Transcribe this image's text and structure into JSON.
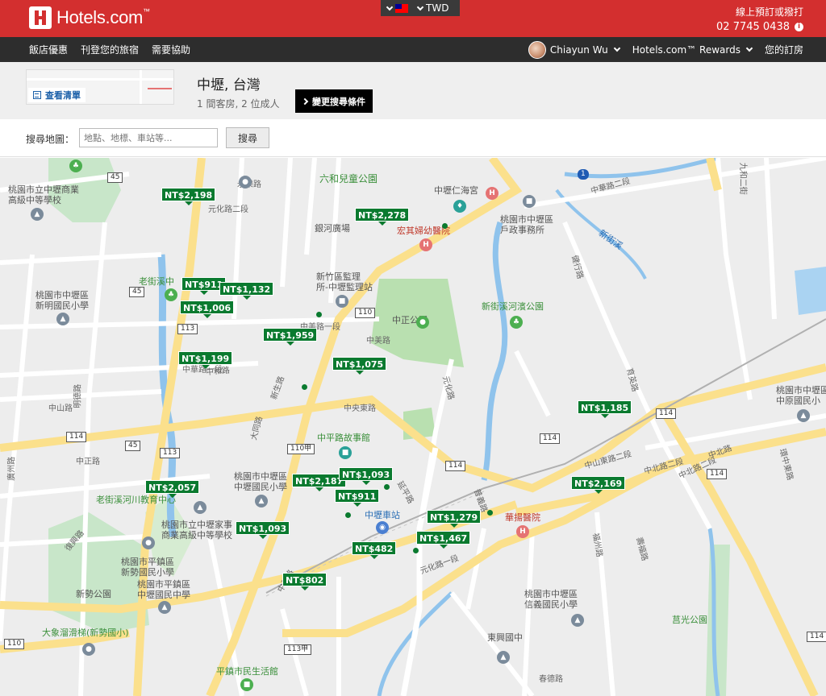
{
  "brand": {
    "name": "Hotels.com",
    "tm": "™"
  },
  "currency": {
    "code": "TWD"
  },
  "header": {
    "help_text": "線上預訂或撥打",
    "phone": "02 7745 0438",
    "info_glyph": "i"
  },
  "nav": {
    "left": [
      "飯店優惠",
      "刊登您的旅宿",
      "需要協助"
    ],
    "user_name": "Chiayun Wu",
    "rewards": "Hotels.com™ Rewards",
    "bookings": "您的訂房"
  },
  "summary": {
    "view_list": "查看清單",
    "destination": "中壢, 台灣",
    "occupancy": "1 間客房, 2 位成人",
    "change_search": "變更搜尋條件"
  },
  "map_search": {
    "label": "搜尋地圖：",
    "placeholder": "地點、地標、車站等...",
    "button": "搜尋"
  },
  "map": {
    "price_pins": [
      {
        "label": "NT$2,198"
      },
      {
        "label": "NT$2,278"
      },
      {
        "label": "NT$911"
      },
      {
        "label": "NT$1,132"
      },
      {
        "label": "NT$1,006"
      },
      {
        "label": "NT$1,959"
      },
      {
        "label": "NT$1,199"
      },
      {
        "label": "NT$1,075"
      },
      {
        "label": "NT$1,185"
      },
      {
        "label": "NT$2,057"
      },
      {
        "label": "NT$2,187"
      },
      {
        "label": "NT$1,093"
      },
      {
        "label": "NT$911"
      },
      {
        "label": "NT$2,169"
      },
      {
        "label": "NT$1,279"
      },
      {
        "label": "NT$1,093"
      },
      {
        "label": "NT$1,467"
      },
      {
        "label": "NT$482"
      },
      {
        "label": "NT$802"
      }
    ],
    "places": [
      {
        "text": "桃園市立中壢商業\n高級中等學校",
        "kind": ""
      },
      {
        "text": "六和兒童公園",
        "kind": "green"
      },
      {
        "text": "中壢仁海宮",
        "kind": ""
      },
      {
        "text": "桃園市中壢區\n戶政事務所",
        "kind": ""
      },
      {
        "text": "銀河廣場",
        "kind": ""
      },
      {
        "text": "宏其婦幼醫院",
        "kind": "red"
      },
      {
        "text": "老街溪中",
        "kind": "green"
      },
      {
        "text": "新竹區監理\n所-中壢監理站",
        "kind": ""
      },
      {
        "text": "桃園市中壢區\n新明國民小學",
        "kind": ""
      },
      {
        "text": "中正公園",
        "kind": ""
      },
      {
        "text": "新街溪河濱公園",
        "kind": "green"
      },
      {
        "text": "中平路故事館",
        "kind": "green"
      },
      {
        "text": "桃園市中壢區\n中原國民小",
        "kind": ""
      },
      {
        "text": "桃園市中壢區\n中壢國民小學",
        "kind": ""
      },
      {
        "text": "老街溪河川教育中心",
        "kind": "green"
      },
      {
        "text": "桃園市立中壢家事\n商業高級中等學校",
        "kind": ""
      },
      {
        "text": "中壢車站",
        "kind": "blue"
      },
      {
        "text": "華揚醫院",
        "kind": "red"
      },
      {
        "text": "桃園市平鎮區\n新勢國民小學",
        "kind": ""
      },
      {
        "text": "桃園市平鎮區\n中壢國民中學",
        "kind": ""
      },
      {
        "text": "新勢公園",
        "kind": ""
      },
      {
        "text": "桃園市中壢區\n信義國民小學",
        "kind": ""
      },
      {
        "text": "大象溜滑梯(新勢國小)",
        "kind": "green"
      },
      {
        "text": "東興國中",
        "kind": ""
      },
      {
        "text": "莒光公園",
        "kind": "green"
      },
      {
        "text": "平鎮市民生活館",
        "kind": "green"
      },
      {
        "text": "新街溪",
        "kind": "blue"
      }
    ],
    "roads": [
      "元化路二段",
      "中華路二段",
      "中美路一段",
      "中美路",
      "中央東路",
      "元化路",
      "中山路",
      "中正路",
      "中北路二段",
      "中北路",
      "中和路",
      "延平路",
      "新生路",
      "明德路",
      "廣州路",
      "九和二街",
      "中平路",
      "永樂路",
      "健行路",
      "中山東路二段",
      "中華路一段",
      "環中東路",
      "育英路",
      "壽福路",
      "福州路",
      "春德路",
      "復興路",
      "大同路",
      "普義路",
      "元化路一段",
      "中北路二段"
    ],
    "route_shields": [
      "1",
      "45",
      "45",
      "45",
      "113",
      "113",
      "110",
      "110",
      "114",
      "114",
      "114",
      "114",
      "110甲",
      "113",
      "113甲",
      "114",
      "114",
      "110"
    ]
  }
}
